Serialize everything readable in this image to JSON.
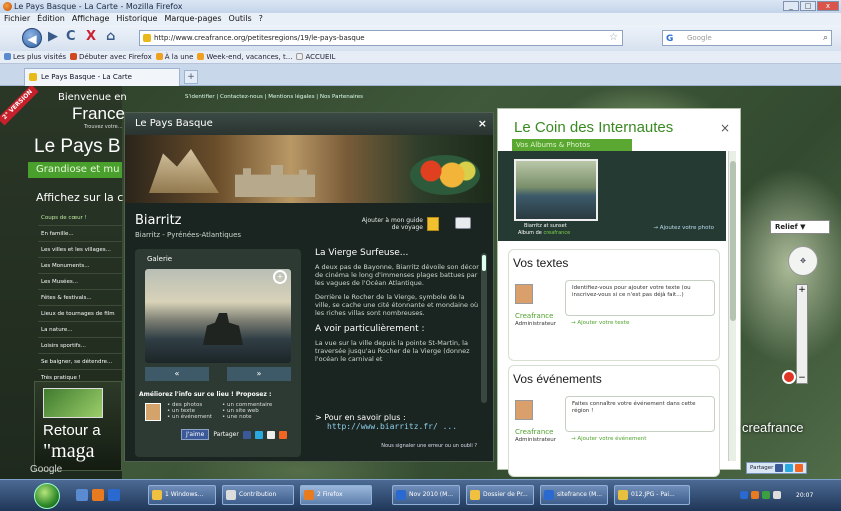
{
  "window": {
    "title": "Le Pays Basque - La Carte - Mozilla Firefox",
    "controls": [
      "_",
      "□",
      "x"
    ]
  },
  "menu": [
    "Fichier",
    "Édition",
    "Affichage",
    "Historique",
    "Marque-pages",
    "Outils",
    "?"
  ],
  "nav": {
    "url": "http://www.creafrance.org/petitesregions/19/le-pays-basque",
    "search_placeholder": "Google",
    "back": "◀",
    "fwd": "▶",
    "reload": "C",
    "stop": "X",
    "home": "⌂"
  },
  "bookmarks": [
    "Les plus visités",
    "Débuter avec Firefox",
    "À la une",
    "Week-end, vacances, t...",
    "ACCUEIL"
  ],
  "tab": {
    "label": "Le Pays Basque - La Carte",
    "new": "+"
  },
  "topstrip": "S'identifier | Contactez-nous | Mentions légales | Nos Partenaires",
  "sidebar": {
    "ribbon": "2° VERSION",
    "welcome": "Bienvenue en",
    "brand": "France",
    "tagline": "Trouvez votre...",
    "title": "Le Pays B",
    "grandiose": "Grandiose et mu",
    "affichez": "Affichez sur la c",
    "items": [
      "Coups de cœur !",
      "En famille...",
      "Les villes et les villages...",
      "Les Monuments...",
      "Les Musées...",
      "Fêtes & festivals...",
      "Lieux de tournages de film",
      "La nature...",
      "Loisirs sportifs...",
      "Se baigner, se détendre...",
      "Très pratique !"
    ],
    "promo_retour": "Retour a",
    "promo_maga": "\"maga"
  },
  "panel": {
    "header": "Le Pays Basque",
    "close": "×",
    "place": "Biarritz",
    "place_sub": "Biarritz - Pyrénées-Atlantiques",
    "add_guide": "Ajouter à mon guide de voyage",
    "gallery_label": "Galerie",
    "prev": "«",
    "next": "»",
    "ameliorez": "Améliorez l'info sur ce lieu ! Proposez :",
    "col1": [
      "• des photos",
      "• un texte",
      "• un événement"
    ],
    "col2": [
      "• un commentaire",
      "• un site web",
      "• une note"
    ],
    "jaime": "J'aime",
    "partager": "Partager",
    "text_title": "La Vierge Surfeuse...",
    "p1": "A deux pas de Bayonne, Biarritz dévoile son décor de cinéma le long d'immenses plages battues par les vagues de l'Océan Atlantique.",
    "p2": "Derrière le Rocher de la Vierge, symbole de la ville, se cache une cité étonnante et mondaine où les riches villas sont nombreuses.",
    "voir_title": "A voir particulièrement :",
    "p3": "La vue sur la ville depuis la pointe St-Martin, la traversée jusqu'au Rocher de la Vierge (donnez l'océan le carnival et",
    "voirplus": "> Pour en savoir plus :",
    "voirplus_url": "http://www.biarritz.fr/ ...",
    "signaler": "Nous signaler une erreur ou un oubli ?"
  },
  "corner": {
    "title": "Le Coin des Internautes",
    "close": "×",
    "sub": "Vos Albums & Photos",
    "album_cap1": "Biarritz at sunset",
    "album_cap2a": "Album de ",
    "album_cap2b": "creafrance",
    "ajout_photo": "→ Ajoutez votre photo",
    "textes_title": "Vos textes",
    "textes_msg": "Identifiez-vous pour ajouter votre texte (ou inscrivez-vous si ce n'est pas déjà fait...)",
    "who": "Creafrance",
    "role": "Administrateur",
    "textes_act": "→ Ajouter votre texte",
    "events_title": "Vos événements",
    "events_msg": "Faites connaître votre événement dans cette région !",
    "events_act": "→ Ajouter votre événement"
  },
  "map": {
    "relief": "Relief ▼",
    "partager": "Partager",
    "logo": "creafrance",
    "google": "Google"
  },
  "taskbar": {
    "items": [
      "1 Windows...",
      "Contribution",
      "2 Firefox",
      "Nov 2010 (M...",
      "Dossier de Pr...",
      "sitefrance (M...",
      "012.JPG - Pai..."
    ],
    "time": "20:07",
    "lang": "FR"
  }
}
